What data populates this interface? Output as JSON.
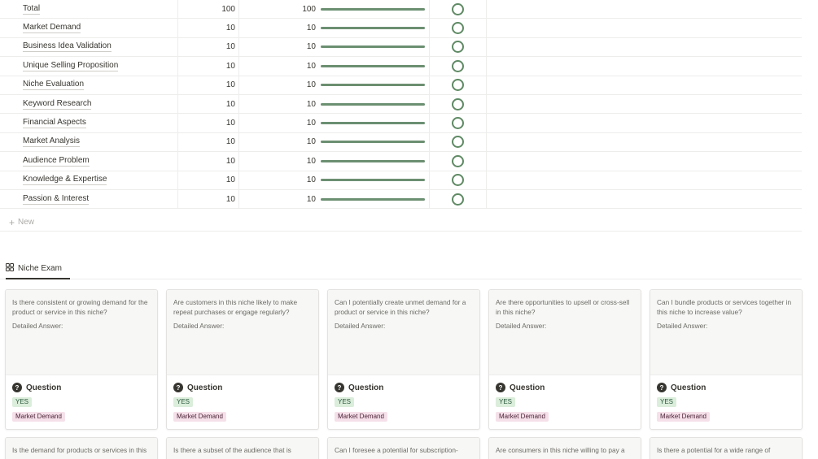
{
  "table": {
    "rows": [
      {
        "name": "Total",
        "value1": "100",
        "value2": "100",
        "progress": 1.0
      },
      {
        "name": "Market Demand",
        "value1": "10",
        "value2": "10",
        "progress": 1.0
      },
      {
        "name": "Business Idea Validation",
        "value1": "10",
        "value2": "10",
        "progress": 1.0
      },
      {
        "name": "Unique Selling Proposition",
        "value1": "10",
        "value2": "10",
        "progress": 1.0
      },
      {
        "name": "Niche Evaluation",
        "value1": "10",
        "value2": "10",
        "progress": 1.0
      },
      {
        "name": "Keyword Research",
        "value1": "10",
        "value2": "10",
        "progress": 1.0
      },
      {
        "name": "Financial Aspects",
        "value1": "10",
        "value2": "10",
        "progress": 1.0
      },
      {
        "name": "Market Analysis",
        "value1": "10",
        "value2": "10",
        "progress": 1.0
      },
      {
        "name": "Audience Problem",
        "value1": "10",
        "value2": "10",
        "progress": 1.0
      },
      {
        "name": "Knowledge & Expertise",
        "value1": "10",
        "value2": "10",
        "progress": 1.0
      },
      {
        "name": "Passion & Interest",
        "value1": "10",
        "value2": "10",
        "progress": 1.0
      }
    ],
    "new_label": "New"
  },
  "tab": {
    "label": "Niche Exam",
    "icon": "gallery-icon"
  },
  "cards": [
    {
      "question": "Is there consistent or growing demand for the product or service in this niche?",
      "answer_label": "Detailed Answer:",
      "title": "Question",
      "status": "YES",
      "category": "Market Demand"
    },
    {
      "question": "Are customers in this niche likely to make repeat purchases or engage regularly?",
      "answer_label": "Detailed Answer:",
      "title": "Question",
      "status": "YES",
      "category": "Market Demand"
    },
    {
      "question": "Can I potentially create unmet demand for a product or service in this niche?",
      "answer_label": "Detailed Answer:",
      "title": "Question",
      "status": "YES",
      "category": "Market Demand"
    },
    {
      "question": "Are there opportunities to upsell or cross-sell in this niche?",
      "answer_label": "Detailed Answer:",
      "title": "Question",
      "status": "YES",
      "category": "Market Demand"
    },
    {
      "question": "Can I bundle products or services together in this niche to increase value?",
      "answer_label": "Detailed Answer:",
      "title": "Question",
      "status": "YES",
      "category": "Market Demand"
    }
  ],
  "cards_row2": [
    {
      "question": "Is the demand for products or services in this"
    },
    {
      "question": "Is there a subset of the audience that is"
    },
    {
      "question": "Can I foresee a potential for subscription-"
    },
    {
      "question": "Are consumers in this niche willing to pay a"
    },
    {
      "question": "Is there a potential for a wide range of"
    }
  ],
  "colors": {
    "progress_fill": "#6b8f71",
    "check_ring": "#5f8a64",
    "yes_tag_bg": "#dbeddb",
    "category_tag_bg": "#f5e0e9"
  }
}
